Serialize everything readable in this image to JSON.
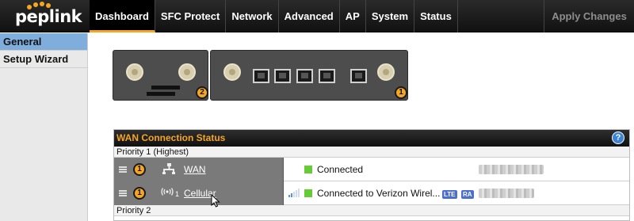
{
  "brand": {
    "logo_text": "peplink",
    "accent": "#f5a623"
  },
  "nav": {
    "items": [
      {
        "label": "Dashboard",
        "active": true
      },
      {
        "label": "SFC Protect"
      },
      {
        "label": "Network"
      },
      {
        "label": "Advanced"
      },
      {
        "label": "AP"
      },
      {
        "label": "System"
      },
      {
        "label": "Status"
      }
    ],
    "apply_label": "Apply Changes"
  },
  "sidebar": {
    "items": [
      {
        "label": "General",
        "active": true
      },
      {
        "label": "Setup Wizard"
      }
    ]
  },
  "devices": [
    {
      "badge": "2"
    },
    {
      "badge": "1"
    }
  ],
  "wan": {
    "title": "WAN Connection Status",
    "help_icon": "?",
    "priority1_label": "Priority 1 (Highest)",
    "priority2_label": "Priority 2",
    "rows": [
      {
        "priority": "1",
        "icon": "network-icon",
        "name": "WAN",
        "status": "Connected",
        "status_color": "#66cc33"
      },
      {
        "priority": "1",
        "icon": "cellular-icon",
        "sub_number": "1",
        "name": "Cellular",
        "status": "Connected to Verizon Wirel...",
        "status_color": "#66cc33",
        "tags": [
          "LTE",
          "RA"
        ]
      }
    ]
  }
}
